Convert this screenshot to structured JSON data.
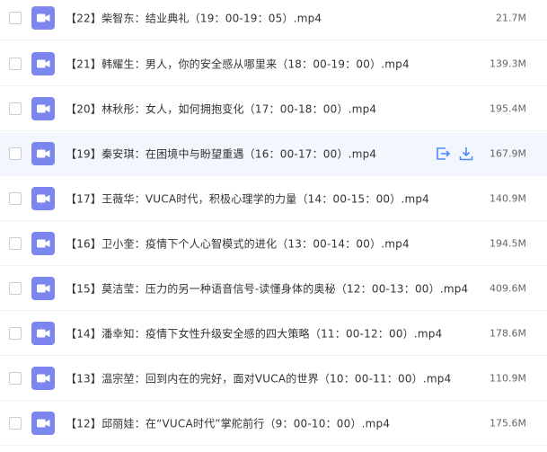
{
  "colors": {
    "video_icon": "#7b86ee",
    "action_icon": "#4b8df8",
    "hover_background": "#f3f6fd",
    "text": "#333333",
    "size_text": "#666666"
  },
  "icons": {
    "file": "video-file-icon",
    "share": "share-icon",
    "download": "download-icon"
  },
  "files": [
    {
      "name": "【22】柴智东：结业典礼（19：00-19：05）.mp4",
      "size": "21.7M"
    },
    {
      "name": "【21】韩耀生：男人，你的安全感从哪里来（18：00-19：00）.mp4",
      "size": "139.3M"
    },
    {
      "name": "【20】林秋彤：女人，如何拥抱变化（17：00-18：00）.mp4",
      "size": "195.4M"
    },
    {
      "name": "【19】秦安琪：在困境中与盼望重遇（16：00-17：00）.mp4",
      "size": "167.9M",
      "hovered": true
    },
    {
      "name": "【17】王薇华：VUCA时代，积极心理学的力量（14：00-15：00）.mp4",
      "size": "140.9M"
    },
    {
      "name": "【16】卫小奎：疫情下个人心智模式的进化（13：00-14：00）.mp4",
      "size": "194.5M"
    },
    {
      "name": "【15】莫洁莹：压力的另一种语音信号-读懂身体的奥秘（12：00-13：00）.mp4",
      "size": "409.6M"
    },
    {
      "name": "【14】潘幸知：疫情下女性升级安全感的四大策略（11：00-12：00）.mp4",
      "size": "178.6M"
    },
    {
      "name": "【13】温宗堃：回到内在的完好，面对VUCA的世界（10：00-11：00）.mp4",
      "size": "110.9M"
    },
    {
      "name": "【12】邱丽娃：在“VUCA时代”掌舵前行（9：00-10：00）.mp4",
      "size": "175.6M"
    }
  ]
}
